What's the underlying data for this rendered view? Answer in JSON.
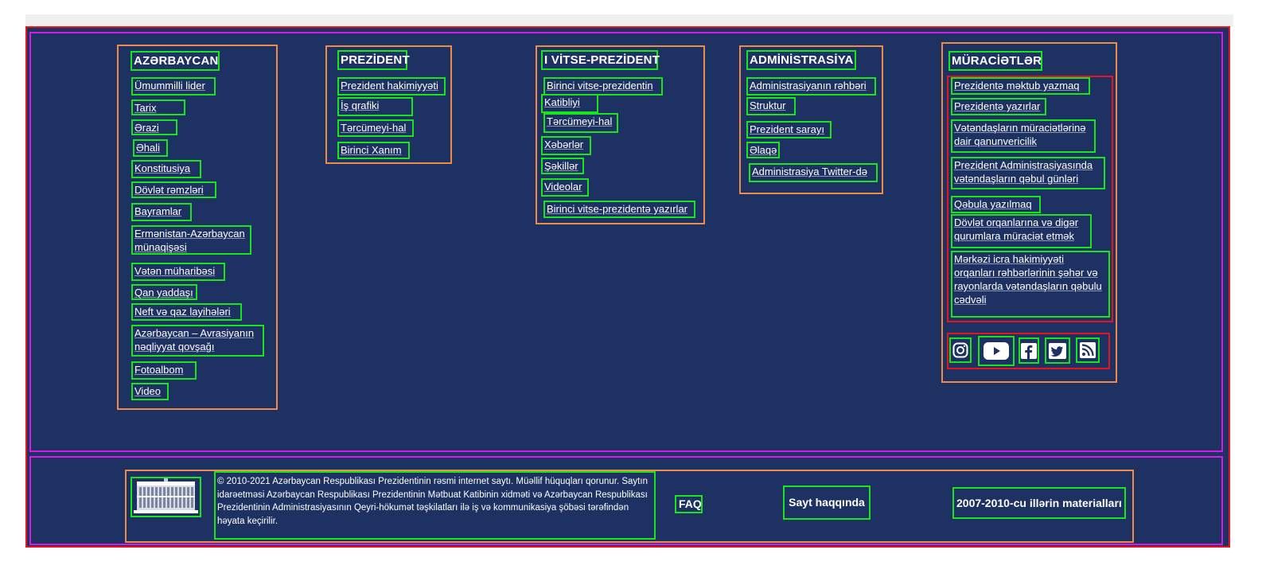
{
  "columns": [
    {
      "title": "AZƏRBAYCAN",
      "links": [
        "Ümummilli lider",
        "Tarix",
        "Ərazi",
        "Əhali",
        "Konstitusiya",
        "Dövlət rəmzləri",
        "Bayramlar",
        "Ermənistan-Azərbaycan münaqişəsi",
        "Vətən müharibəsi",
        "Qan yaddaşı",
        "Neft və qaz layihələri",
        "Azərbaycan – Avrasiyanın nəqliyyat qovşağı",
        "Fotoalbom",
        "Video"
      ]
    },
    {
      "title": "PREZİDENT",
      "links": [
        "Prezident hakimiyyəti",
        "İş qrafiki",
        "Tərcümeyi-hal",
        "Birinci Xanım"
      ]
    },
    {
      "title": "I VİTSE-PREZİDENT",
      "links": [
        "Birinci vitse-prezidentin",
        "Katibliyi",
        "Tərcümeyi-hal",
        "Xəbərlər",
        "Şəkillər",
        "Videolar",
        "Birinci vitse-prezidentə yazırlar"
      ]
    },
    {
      "title": "ADMİNİSTRASİYA",
      "links": [
        "Administrasiyanın rəhbəri",
        "Struktur",
        "Prezident sarayı",
        "Əlaqə",
        "Administrasiya Twitter-də"
      ]
    },
    {
      "title": "MÜRACİƏTLƏR",
      "links": [
        "Prezidentə məktub yazmaq",
        "Prezidentə yazırlar",
        "Vətəndaşların müraciətlərinə dair qanunvericilik",
        "Prezident Administrasiyasında vətəndaşların qəbul günləri",
        "Qəbula yazılmaq",
        "Dövlət orqanlarına və digər qurumlara müraciət etmək",
        "Mərkəzi icra hakimiyyəti orqanları rəhbərlərinin şəhər və rayonlarda vətəndaşların qəbulu cədvəli"
      ]
    }
  ],
  "social": [
    {
      "icon": "instagram-icon"
    },
    {
      "icon": "youtube-icon"
    },
    {
      "icon": "facebook-icon"
    },
    {
      "icon": "twitter-icon"
    },
    {
      "icon": "rss-icon"
    }
  ],
  "footer": {
    "copyright": "© 2010-2021 Azərbaycan Respublikası Prezidentinin rəsmi internet saytı. Müəllif hüquqları qorunur. Saytın idarəetməsi Azərbaycan Respublikası Prezidentinin Mətbuat Katibinin xidməti və Azərbaycan Respublikası Prezidentinin Administrasiyasının Qeyri-hökumət təşkilatları ilə iş və kommunikasiya şöbəsi tərəfindən həyata keçirilir.",
    "faq": "FAQ",
    "about": "Sayt haqqında",
    "archive": "2007-2010-cu illərin materialları"
  },
  "colors": {
    "background": "#1e3163",
    "text": "#ffffff"
  }
}
